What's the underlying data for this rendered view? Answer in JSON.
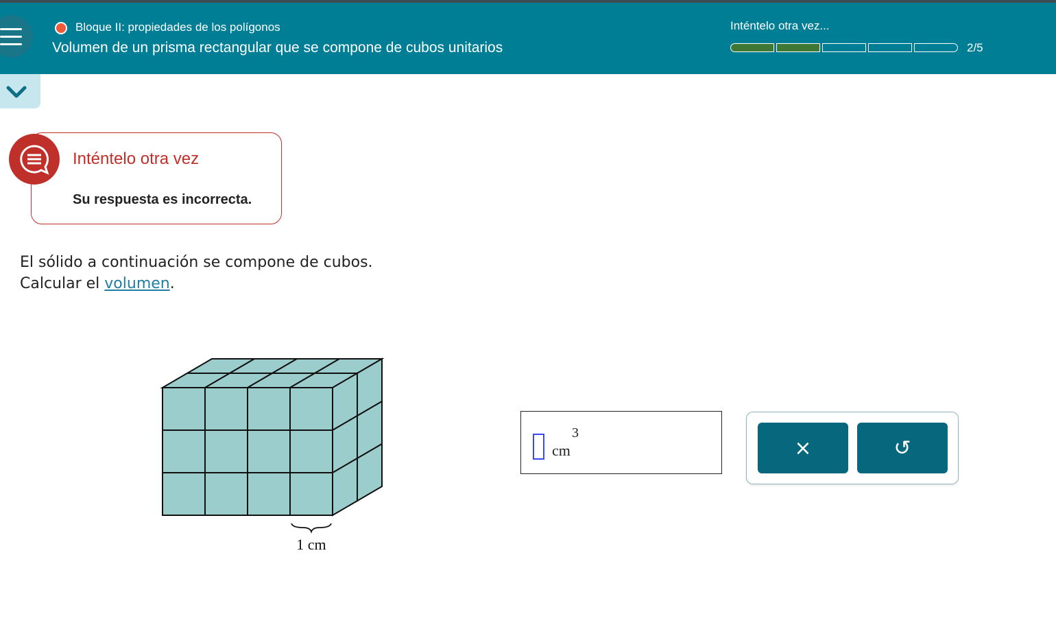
{
  "header": {
    "block_title": "Bloque II: propiedades de los polígonos",
    "lesson_title": "Volumen de un prisma rectangular que se compone de cubos unitarios",
    "status": "Inténtelo otra vez...",
    "progress": {
      "completed": 2,
      "total": 5,
      "label": "2/5"
    },
    "colors": {
      "bar": "#007e96",
      "done": "#3f7834",
      "dot": "#ee5a3a"
    },
    "icons": {
      "menu": "hamburger-menu-icon",
      "status": "status-dot-icon"
    }
  },
  "collapse": {
    "icon": "chevron-down-icon"
  },
  "feedback": {
    "title": "Inténtelo otra vez",
    "message": "Su respuesta es incorrecta.",
    "icon": "chat-bubble-icon",
    "color": "#c0302a"
  },
  "question": {
    "line1": "El sólido a continuación se compone de cubos.",
    "line2_prefix": "Calcular el ",
    "line2_link": "volumen",
    "line2_suffix": "."
  },
  "figure": {
    "front_columns": 4,
    "rows": 3,
    "depth": 2,
    "label": "1 cm",
    "cube_color": "#9ccdcd"
  },
  "answer": {
    "value": "",
    "unit": "cm",
    "exponent": "3"
  },
  "buttons": {
    "clear": {
      "glyph": "×",
      "icon": "close-icon"
    },
    "undo": {
      "glyph": "↺",
      "icon": "undo-icon"
    },
    "color": "#07677d"
  }
}
